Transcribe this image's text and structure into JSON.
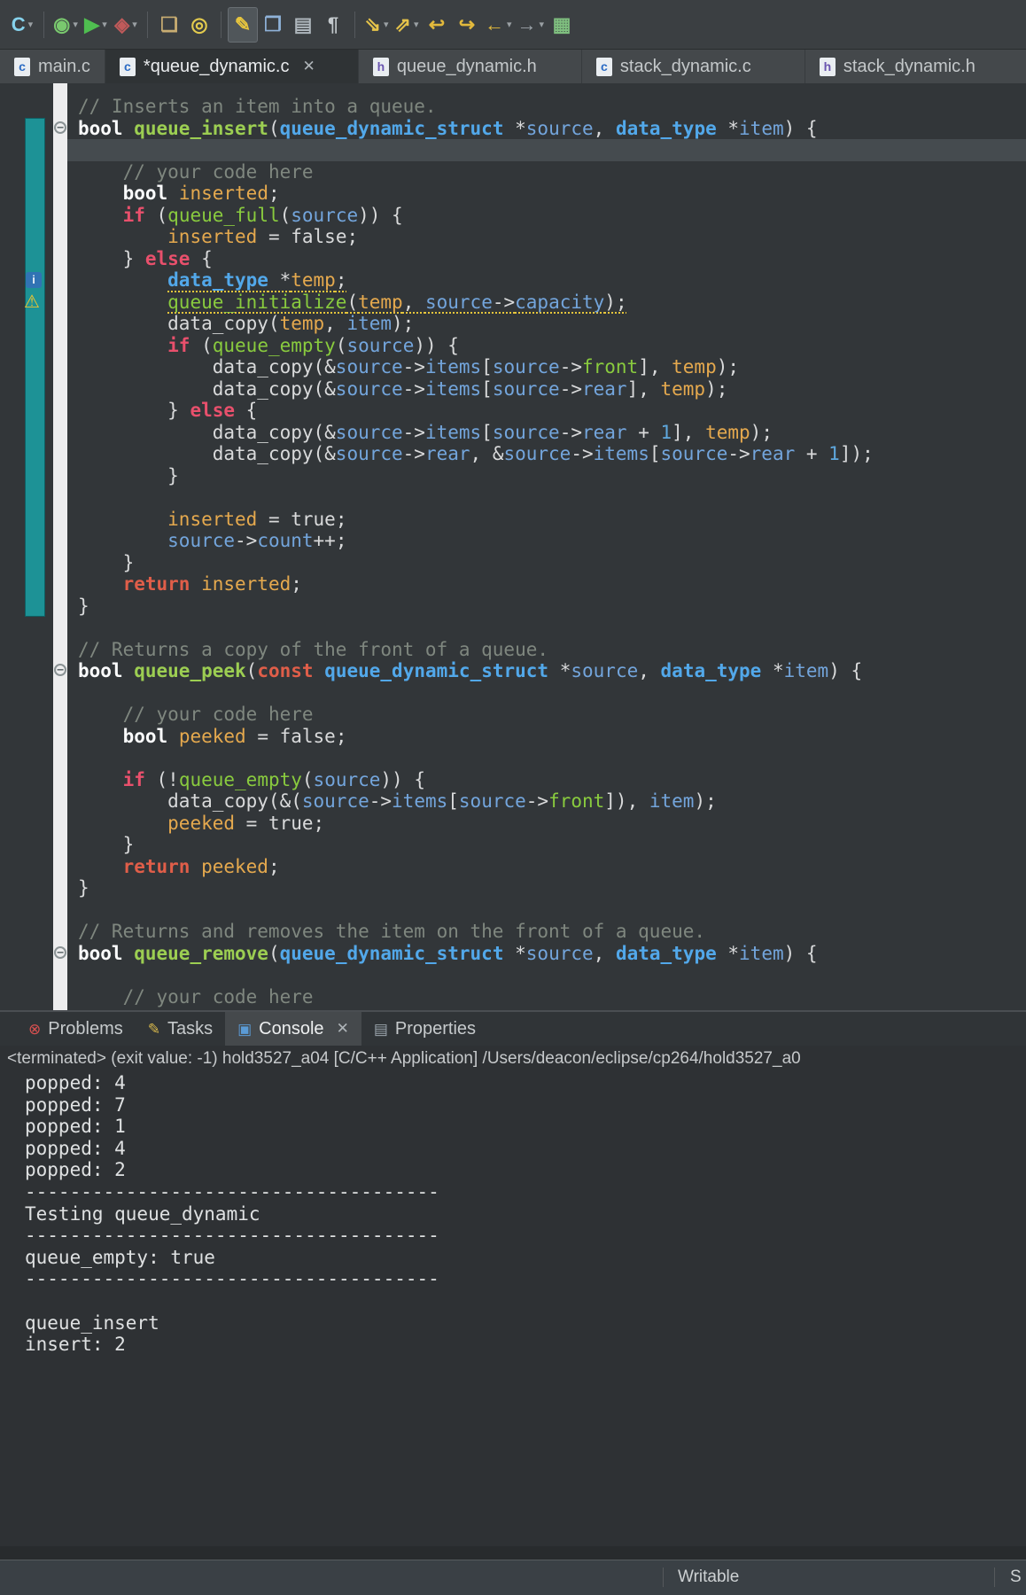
{
  "theme": {
    "toolbar_bg": "#3B3F42",
    "editor_bg": "#323639",
    "gutter_bg": "#EDEDEE",
    "range_bar": "#1D9296",
    "current_line": "#454B4F",
    "warning_underline": "#E6C53C",
    "syntax": {
      "comment": "#7F877F",
      "keyword_flow": "#E8506C",
      "keyword_return_const": "#E05E49",
      "keyword_bool": "#FBFCFD",
      "type": "#52A8EA",
      "function_def": "#9CCE52",
      "function_call": "#89CB3E",
      "variable": "#73A5DC",
      "local": "#E5A94E",
      "number": "#5FA8DE"
    }
  },
  "toolbar": {
    "items": [
      {
        "name": "new-c-project",
        "icon": "new-c-file-icon",
        "glyph": "C",
        "color": "#86D2EC",
        "dropdown": true
      },
      {
        "type": "sep"
      },
      {
        "name": "debug",
        "icon": "debug-icon",
        "glyph": "◉",
        "color": "#79C86E",
        "dropdown": true
      },
      {
        "name": "run",
        "icon": "run-icon",
        "glyph": "▶",
        "color": "#4FBE50",
        "dropdown": true
      },
      {
        "name": "external-tools",
        "icon": "external-tools-icon",
        "glyph": "◈",
        "color": "#C05A5A",
        "dropdown": true
      },
      {
        "type": "sep"
      },
      {
        "name": "open-element",
        "icon": "open-folder-icon",
        "glyph": "❏",
        "color": "#C9AD72"
      },
      {
        "name": "search",
        "icon": "flashlight-icon",
        "glyph": "◎",
        "color": "#E3CB4E"
      },
      {
        "type": "sep"
      },
      {
        "name": "mark-occurrences",
        "icon": "pencil-icon",
        "glyph": "✎",
        "color": "#E8C63E",
        "boxed": true
      },
      {
        "name": "new-wizard",
        "icon": "page-plus-icon",
        "glyph": "❐",
        "color": "#8FB2D8"
      },
      {
        "name": "show-view",
        "icon": "page-lines-icon",
        "glyph": "▤",
        "color": "#AEB6BC"
      },
      {
        "name": "show-whitespace",
        "icon": "pilcrow-icon",
        "glyph": "¶",
        "color": "#C3C9CD"
      },
      {
        "type": "sep"
      },
      {
        "name": "next-annotation",
        "icon": "next-annotation-icon",
        "glyph": "⇘",
        "color": "#E5C34A",
        "dropdown": true
      },
      {
        "name": "previous-annotation",
        "icon": "previous-annotation-icon",
        "glyph": "⇗",
        "color": "#E5C34A",
        "dropdown": true
      },
      {
        "name": "last-edit-location",
        "icon": "bent-left-arrow-icon",
        "glyph": "↩",
        "color": "#E2B93C"
      },
      {
        "name": "next-edit-location",
        "icon": "bent-right-arrow-icon",
        "glyph": "↪",
        "color": "#E2B93C"
      },
      {
        "name": "back",
        "icon": "back-arrow-icon",
        "glyph": "←",
        "color": "#E2B93C",
        "dropdown": true
      },
      {
        "name": "forward",
        "icon": "forward-arrow-icon",
        "glyph": "→",
        "color": "#9CA4AA",
        "dropdown": true
      },
      {
        "name": "pin-editor",
        "icon": "editor-window-icon",
        "glyph": "▦",
        "color": "#7FBF7F"
      }
    ]
  },
  "tabbar": {
    "tabs": [
      {
        "label": "main.c",
        "icon": "c",
        "min": 118
      },
      {
        "label": "*queue_dynamic.c",
        "icon": "c",
        "active": true,
        "closable": true,
        "min": 286
      },
      {
        "label": "queue_dynamic.h",
        "icon": "h",
        "min": 252
      },
      {
        "label": "stack_dynamic.c",
        "icon": "c",
        "min": 252
      },
      {
        "label": "stack_dynamic.h",
        "icon": "h",
        "min": 300
      }
    ]
  },
  "editor": {
    "range": {
      "from": 1,
      "to": 23
    },
    "lines": [
      {
        "tokens": [
          [
            "c",
            "// Inserts an item into a queue."
          ]
        ]
      },
      {
        "fold": true,
        "tokens": [
          [
            "b",
            "bool"
          ],
          [
            "p",
            " "
          ],
          [
            "f",
            "queue_insert"
          ],
          [
            "p",
            "("
          ],
          [
            "t",
            "queue_dynamic_struct"
          ],
          [
            "p",
            " *"
          ],
          [
            "v",
            "source"
          ],
          [
            "p",
            ", "
          ],
          [
            "t",
            "data_type"
          ],
          [
            "p",
            " *"
          ],
          [
            "v",
            "item"
          ],
          [
            "p",
            ") {"
          ]
        ]
      },
      {
        "hl": true,
        "tokens": []
      },
      {
        "tokens": [
          [
            "p",
            "    "
          ],
          [
            "c",
            "// your code here"
          ]
        ]
      },
      {
        "tokens": [
          [
            "p",
            "    "
          ],
          [
            "b",
            "bool"
          ],
          [
            "p",
            " "
          ],
          [
            "l",
            "inserted"
          ],
          [
            "p",
            ";"
          ]
        ]
      },
      {
        "tokens": [
          [
            "p",
            "    "
          ],
          [
            "k",
            "if"
          ],
          [
            "p",
            " ("
          ],
          [
            "g",
            "queue_full"
          ],
          [
            "p",
            "("
          ],
          [
            "v",
            "source"
          ],
          [
            "p",
            ")) {"
          ]
        ]
      },
      {
        "tokens": [
          [
            "p",
            "        "
          ],
          [
            "l",
            "inserted"
          ],
          [
            "p",
            " = false;"
          ]
        ]
      },
      {
        "tokens": [
          [
            "p",
            "    } "
          ],
          [
            "k",
            "else"
          ],
          [
            "p",
            " {"
          ]
        ]
      },
      {
        "info": true,
        "tokens": [
          [
            "p",
            "        "
          ],
          [
            "t u",
            "data_type"
          ],
          [
            "p u",
            " *"
          ],
          [
            "l u",
            "temp"
          ],
          [
            "p u",
            ";"
          ]
        ]
      },
      {
        "warn": true,
        "tokens": [
          [
            "p",
            "        "
          ],
          [
            "g u",
            "queue_initialize"
          ],
          [
            "p u",
            "("
          ],
          [
            "l u",
            "temp"
          ],
          [
            "p u",
            ", "
          ],
          [
            "v u",
            "source"
          ],
          [
            "p u",
            "->"
          ],
          [
            "v u",
            "capacity"
          ],
          [
            "p u",
            ");"
          ]
        ]
      },
      {
        "tokens": [
          [
            "p",
            "        data_copy("
          ],
          [
            "l",
            "temp"
          ],
          [
            "p",
            ", "
          ],
          [
            "v",
            "item"
          ],
          [
            "p",
            ");"
          ]
        ]
      },
      {
        "tokens": [
          [
            "p",
            "        "
          ],
          [
            "k",
            "if"
          ],
          [
            "p",
            " ("
          ],
          [
            "g",
            "queue_empty"
          ],
          [
            "p",
            "("
          ],
          [
            "v",
            "source"
          ],
          [
            "p",
            ")) {"
          ]
        ]
      },
      {
        "tokens": [
          [
            "p",
            "            data_copy(&"
          ],
          [
            "v",
            "source"
          ],
          [
            "p",
            "->"
          ],
          [
            "v",
            "items"
          ],
          [
            "p",
            "["
          ],
          [
            "v",
            "source"
          ],
          [
            "p",
            "->"
          ],
          [
            "g",
            "front"
          ],
          [
            "p",
            "], "
          ],
          [
            "l",
            "temp"
          ],
          [
            "p",
            ");"
          ]
        ]
      },
      {
        "tokens": [
          [
            "p",
            "            data_copy(&"
          ],
          [
            "v",
            "source"
          ],
          [
            "p",
            "->"
          ],
          [
            "v",
            "items"
          ],
          [
            "p",
            "["
          ],
          [
            "v",
            "source"
          ],
          [
            "p",
            "->"
          ],
          [
            "v",
            "rear"
          ],
          [
            "p",
            "], "
          ],
          [
            "l",
            "temp"
          ],
          [
            "p",
            ");"
          ]
        ]
      },
      {
        "tokens": [
          [
            "p",
            "        } "
          ],
          [
            "k",
            "else"
          ],
          [
            "p",
            " {"
          ]
        ]
      },
      {
        "tokens": [
          [
            "p",
            "            data_copy(&"
          ],
          [
            "v",
            "source"
          ],
          [
            "p",
            "->"
          ],
          [
            "v",
            "items"
          ],
          [
            "p",
            "["
          ],
          [
            "v",
            "source"
          ],
          [
            "p",
            "->"
          ],
          [
            "v",
            "rear"
          ],
          [
            "p",
            " + "
          ],
          [
            "n",
            "1"
          ],
          [
            "p",
            "], "
          ],
          [
            "l",
            "temp"
          ],
          [
            "p",
            ");"
          ]
        ]
      },
      {
        "tokens": [
          [
            "p",
            "            data_copy(&"
          ],
          [
            "v",
            "source"
          ],
          [
            "p",
            "->"
          ],
          [
            "v",
            "rear"
          ],
          [
            "p",
            ", &"
          ],
          [
            "v",
            "source"
          ],
          [
            "p",
            "->"
          ],
          [
            "v",
            "items"
          ],
          [
            "p",
            "["
          ],
          [
            "v",
            "source"
          ],
          [
            "p",
            "->"
          ],
          [
            "v",
            "rear"
          ],
          [
            "p",
            " + "
          ],
          [
            "n",
            "1"
          ],
          [
            "p",
            "]);"
          ]
        ]
      },
      {
        "tokens": [
          [
            "p",
            "        }"
          ]
        ]
      },
      {
        "tokens": []
      },
      {
        "tokens": [
          [
            "p",
            "        "
          ],
          [
            "l",
            "inserted"
          ],
          [
            "p",
            " = true;"
          ]
        ]
      },
      {
        "tokens": [
          [
            "p",
            "        "
          ],
          [
            "v",
            "source"
          ],
          [
            "p",
            "->"
          ],
          [
            "v",
            "count"
          ],
          [
            "p",
            "++;"
          ]
        ]
      },
      {
        "tokens": [
          [
            "p",
            "    }"
          ]
        ]
      },
      {
        "tokens": [
          [
            "p",
            "    "
          ],
          [
            "r",
            "return"
          ],
          [
            "p",
            " "
          ],
          [
            "l",
            "inserted"
          ],
          [
            "p",
            ";"
          ]
        ]
      },
      {
        "tokens": [
          [
            "p",
            "}"
          ]
        ]
      },
      {
        "tokens": []
      },
      {
        "tokens": [
          [
            "c",
            "// Returns a copy of the front of a queue."
          ]
        ]
      },
      {
        "fold": true,
        "tokens": [
          [
            "b",
            "bool"
          ],
          [
            "p",
            " "
          ],
          [
            "f",
            "queue_peek"
          ],
          [
            "p",
            "("
          ],
          [
            "r",
            "const"
          ],
          [
            "p",
            " "
          ],
          [
            "t",
            "queue_dynamic_struct"
          ],
          [
            "p",
            " *"
          ],
          [
            "v",
            "source"
          ],
          [
            "p",
            ", "
          ],
          [
            "t",
            "data_type"
          ],
          [
            "p",
            " *"
          ],
          [
            "v",
            "item"
          ],
          [
            "p",
            ") {"
          ]
        ]
      },
      {
        "tokens": []
      },
      {
        "tokens": [
          [
            "p",
            "    "
          ],
          [
            "c",
            "// your code here"
          ]
        ]
      },
      {
        "tokens": [
          [
            "p",
            "    "
          ],
          [
            "b",
            "bool"
          ],
          [
            "p",
            " "
          ],
          [
            "l",
            "peeked"
          ],
          [
            "p",
            " = false;"
          ]
        ]
      },
      {
        "tokens": []
      },
      {
        "tokens": [
          [
            "p",
            "    "
          ],
          [
            "k",
            "if"
          ],
          [
            "p",
            " (!"
          ],
          [
            "g",
            "queue_empty"
          ],
          [
            "p",
            "("
          ],
          [
            "v",
            "source"
          ],
          [
            "p",
            ")) {"
          ]
        ]
      },
      {
        "tokens": [
          [
            "p",
            "        data_copy(&("
          ],
          [
            "v",
            "source"
          ],
          [
            "p",
            "->"
          ],
          [
            "v",
            "items"
          ],
          [
            "p",
            "["
          ],
          [
            "v",
            "source"
          ],
          [
            "p",
            "->"
          ],
          [
            "g",
            "front"
          ],
          [
            "p",
            "]), "
          ],
          [
            "v",
            "item"
          ],
          [
            "p",
            ");"
          ]
        ]
      },
      {
        "tokens": [
          [
            "p",
            "        "
          ],
          [
            "l",
            "peeked"
          ],
          [
            "p",
            " = true;"
          ]
        ]
      },
      {
        "tokens": [
          [
            "p",
            "    }"
          ]
        ]
      },
      {
        "tokens": [
          [
            "p",
            "    "
          ],
          [
            "r",
            "return"
          ],
          [
            "p",
            " "
          ],
          [
            "l",
            "peeked"
          ],
          [
            "p",
            ";"
          ]
        ]
      },
      {
        "tokens": [
          [
            "p",
            "}"
          ]
        ]
      },
      {
        "tokens": []
      },
      {
        "tokens": [
          [
            "c",
            "// Returns and removes the item on the front of a queue."
          ]
        ]
      },
      {
        "fold": true,
        "tokens": [
          [
            "b",
            "bool"
          ],
          [
            "p",
            " "
          ],
          [
            "f",
            "queue_remove"
          ],
          [
            "p",
            "("
          ],
          [
            "t",
            "queue_dynamic_struct"
          ],
          [
            "p",
            " *"
          ],
          [
            "v",
            "source"
          ],
          [
            "p",
            ", "
          ],
          [
            "t",
            "data_type"
          ],
          [
            "p",
            " *"
          ],
          [
            "v",
            "item"
          ],
          [
            "p",
            ") {"
          ]
        ]
      },
      {
        "tokens": []
      },
      {
        "tokens": [
          [
            "p",
            "    "
          ],
          [
            "c",
            "// your code here"
          ]
        ]
      }
    ]
  },
  "console": {
    "tabs": [
      {
        "label": "Problems",
        "icon_name": "problems-icon",
        "glyph": "⊗",
        "color": "#D85050"
      },
      {
        "label": "Tasks",
        "icon_name": "tasks-icon",
        "glyph": "✎",
        "color": "#D8B84C"
      },
      {
        "label": "Console",
        "icon_name": "console-icon",
        "glyph": "▣",
        "color": "#5B9BD5",
        "active": true,
        "closable": true
      },
      {
        "label": "Properties",
        "icon_name": "properties-icon",
        "glyph": "▤",
        "color": "#9AA4AC"
      }
    ],
    "terminated": "<terminated> (exit value: -1) hold3527_a04 [C/C++ Application] /Users/deacon/eclipse/cp264/hold3527_a0",
    "output": [
      "popped: 4",
      "popped: 7",
      "popped: 1",
      "popped: 4",
      "popped: 2",
      "-------------------------------------",
      "Testing queue_dynamic",
      "-------------------------------------",
      "queue_empty: true",
      "-------------------------------------",
      "",
      "queue_insert",
      "insert: 2"
    ]
  },
  "statusbar": {
    "writable": "Writable",
    "insert_mode": "S"
  }
}
